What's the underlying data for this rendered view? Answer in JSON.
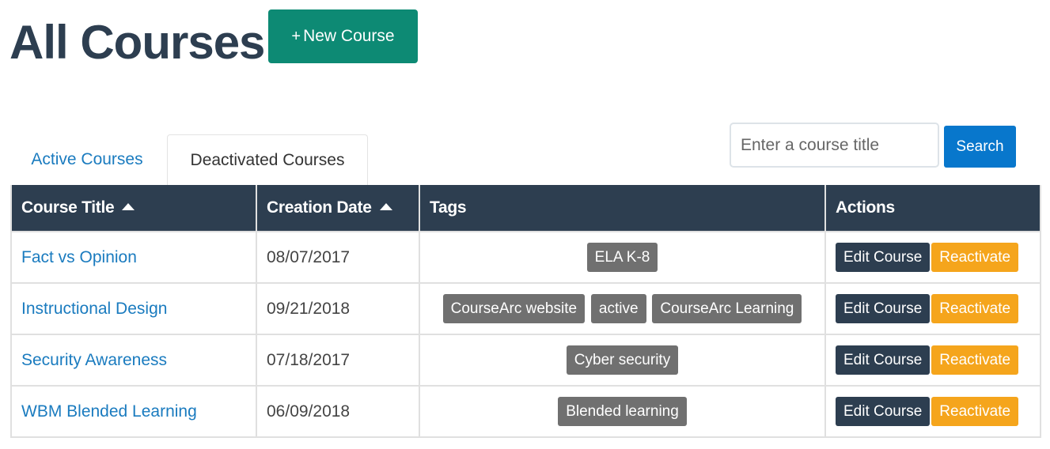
{
  "header": {
    "title": "All Courses",
    "new_course_label": "New Course",
    "new_course_icon": "plus-icon"
  },
  "tabs": [
    {
      "label": "Active Courses",
      "selected": false
    },
    {
      "label": "Deactivated Courses",
      "selected": true
    }
  ],
  "search": {
    "placeholder": "Enter a course title",
    "value": "",
    "button_label": "Search"
  },
  "table": {
    "columns": [
      {
        "label": "Course Title",
        "sortable": true,
        "sort_icon": "sort-asc-icon"
      },
      {
        "label": "Creation Date",
        "sortable": true,
        "sort_icon": "sort-asc-icon"
      },
      {
        "label": "Tags",
        "sortable": false
      },
      {
        "label": "Actions",
        "sortable": false
      }
    ],
    "rows": [
      {
        "title": "Fact vs Opinion",
        "date": "08/07/2017",
        "tags": [
          "ELA K-8"
        ],
        "edit_label": "Edit Course",
        "reactivate_label": "Reactivate"
      },
      {
        "title": "Instructional Design",
        "date": "09/21/2018",
        "tags": [
          "CourseArc website",
          "active",
          "CourseArc Learning"
        ],
        "edit_label": "Edit Course",
        "reactivate_label": "Reactivate"
      },
      {
        "title": "Security Awareness",
        "date": "07/18/2017",
        "tags": [
          "Cyber security"
        ],
        "edit_label": "Edit Course",
        "reactivate_label": "Reactivate"
      },
      {
        "title": "WBM Blended Learning",
        "date": "06/09/2018",
        "tags": [
          "Blended learning"
        ],
        "edit_label": "Edit Course",
        "reactivate_label": "Reactivate"
      }
    ]
  },
  "colors": {
    "title": "#2d3e50",
    "new_course_button": "#0d8a74",
    "link": "#1a7bbf",
    "search_button": "#0877cc",
    "table_header": "#2d3e50",
    "tag": "#707070",
    "edit_button": "#2d3e50",
    "reactivate_button": "#f5a51c"
  }
}
